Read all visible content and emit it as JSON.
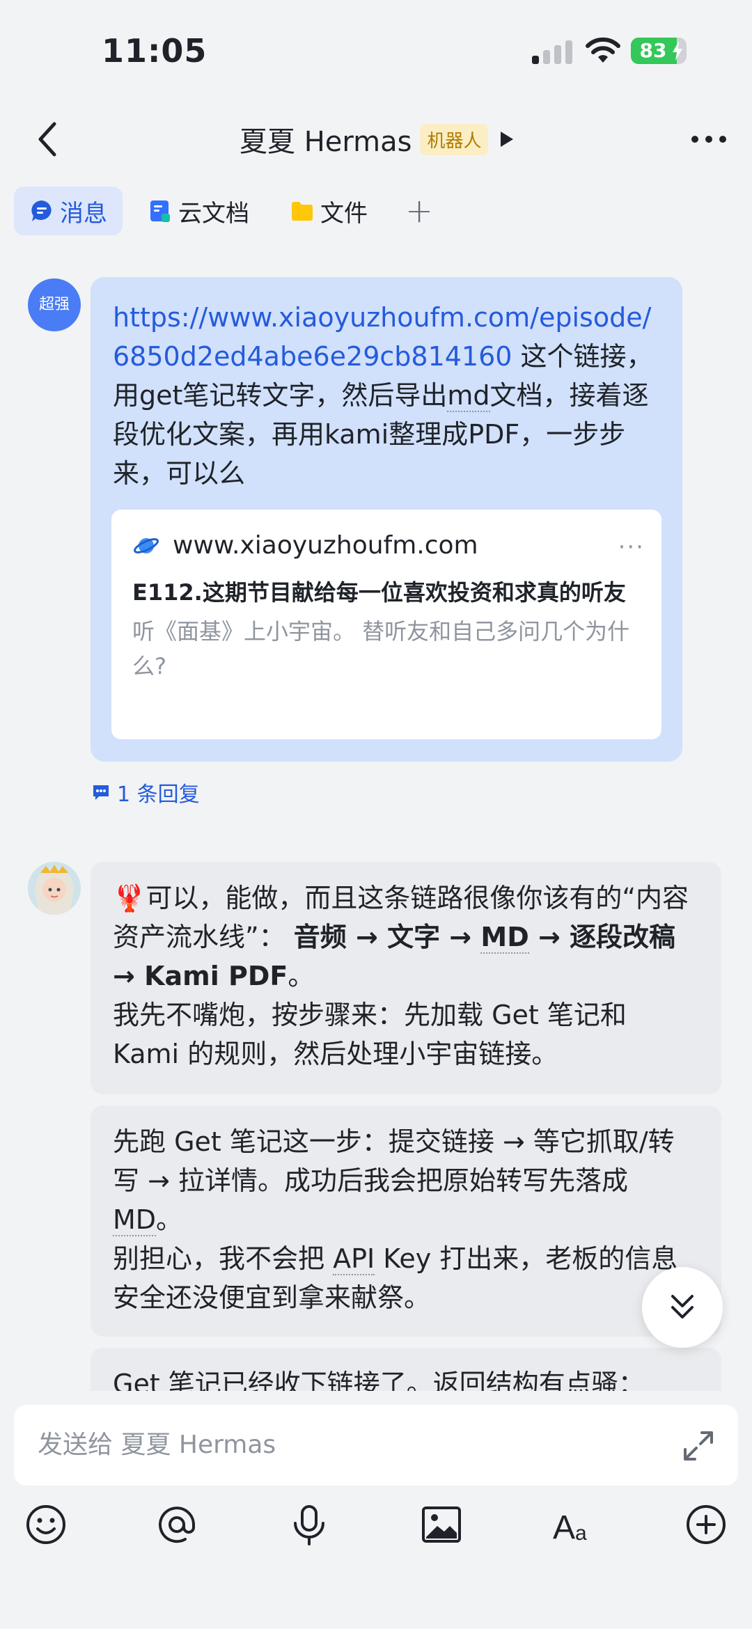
{
  "status": {
    "time": "11:05",
    "battery": "83",
    "battery_level": 0.83
  },
  "header": {
    "title": "夏夏 Hermas",
    "badge": "机器人"
  },
  "tabs": [
    {
      "label": "消息",
      "icon": "message-icon"
    },
    {
      "label": "云文档",
      "icon": "doc-icon"
    },
    {
      "label": "文件",
      "icon": "folder-icon"
    }
  ],
  "user_message": {
    "avatar_label": "超强",
    "link": "https://www.xiaoyuzhoufm.com/episode/6850d2ed4abe6e29cb814160",
    "text_a": " 这个链接，用get笔记转文字，然后导出",
    "text_md": "md",
    "text_b": "文档，接着逐段优化文案，再用kami整理成PDF，一步步来，可以么",
    "card": {
      "domain": "www.xiaoyuzhoufm.com",
      "title": "E112.这期节目献给每一位喜欢投资和求真的听友",
      "desc": "听《面基》上小宇宙。 替听友和自己多问几个为什么?"
    },
    "reply_count": "1 条回复"
  },
  "bot_messages": {
    "m1": {
      "emoji": "🦞",
      "p1": "可以，能做，而且这条链路很像你该有的“内容资产流水线”： ",
      "bold_a": "音频 → 文字 → ",
      "bold_md": "MD",
      "bold_b": " → 逐段改稿 → Kami PDF",
      "p1_end": "。",
      "p2": "我先不嘴炮，按步骤来：先加载 Get 笔记和 Kami 的规则，然后处理小宇宙链接。"
    },
    "m2": {
      "a": "先跑 Get 笔记这一步：提交链接 → 等它抓取/转写 → 拉详情。成功后我会把原始转写先落成 ",
      "md": "MD",
      "b": "。",
      "c": "别担心，我不会把 ",
      "api": "API",
      "d": " Key 打出来，老板的信息安全还没便宜到拿来献祭。"
    },
    "m3": {
      "text": "Get 笔记已经收下链接了。返回结构有点骚："
    }
  },
  "composer": {
    "placeholder": "发送给 夏夏 Hermas"
  },
  "toolbar_icons": [
    "emoji-icon",
    "mention-icon",
    "microphone-icon",
    "image-icon",
    "text-format-icon",
    "plus-icon"
  ]
}
